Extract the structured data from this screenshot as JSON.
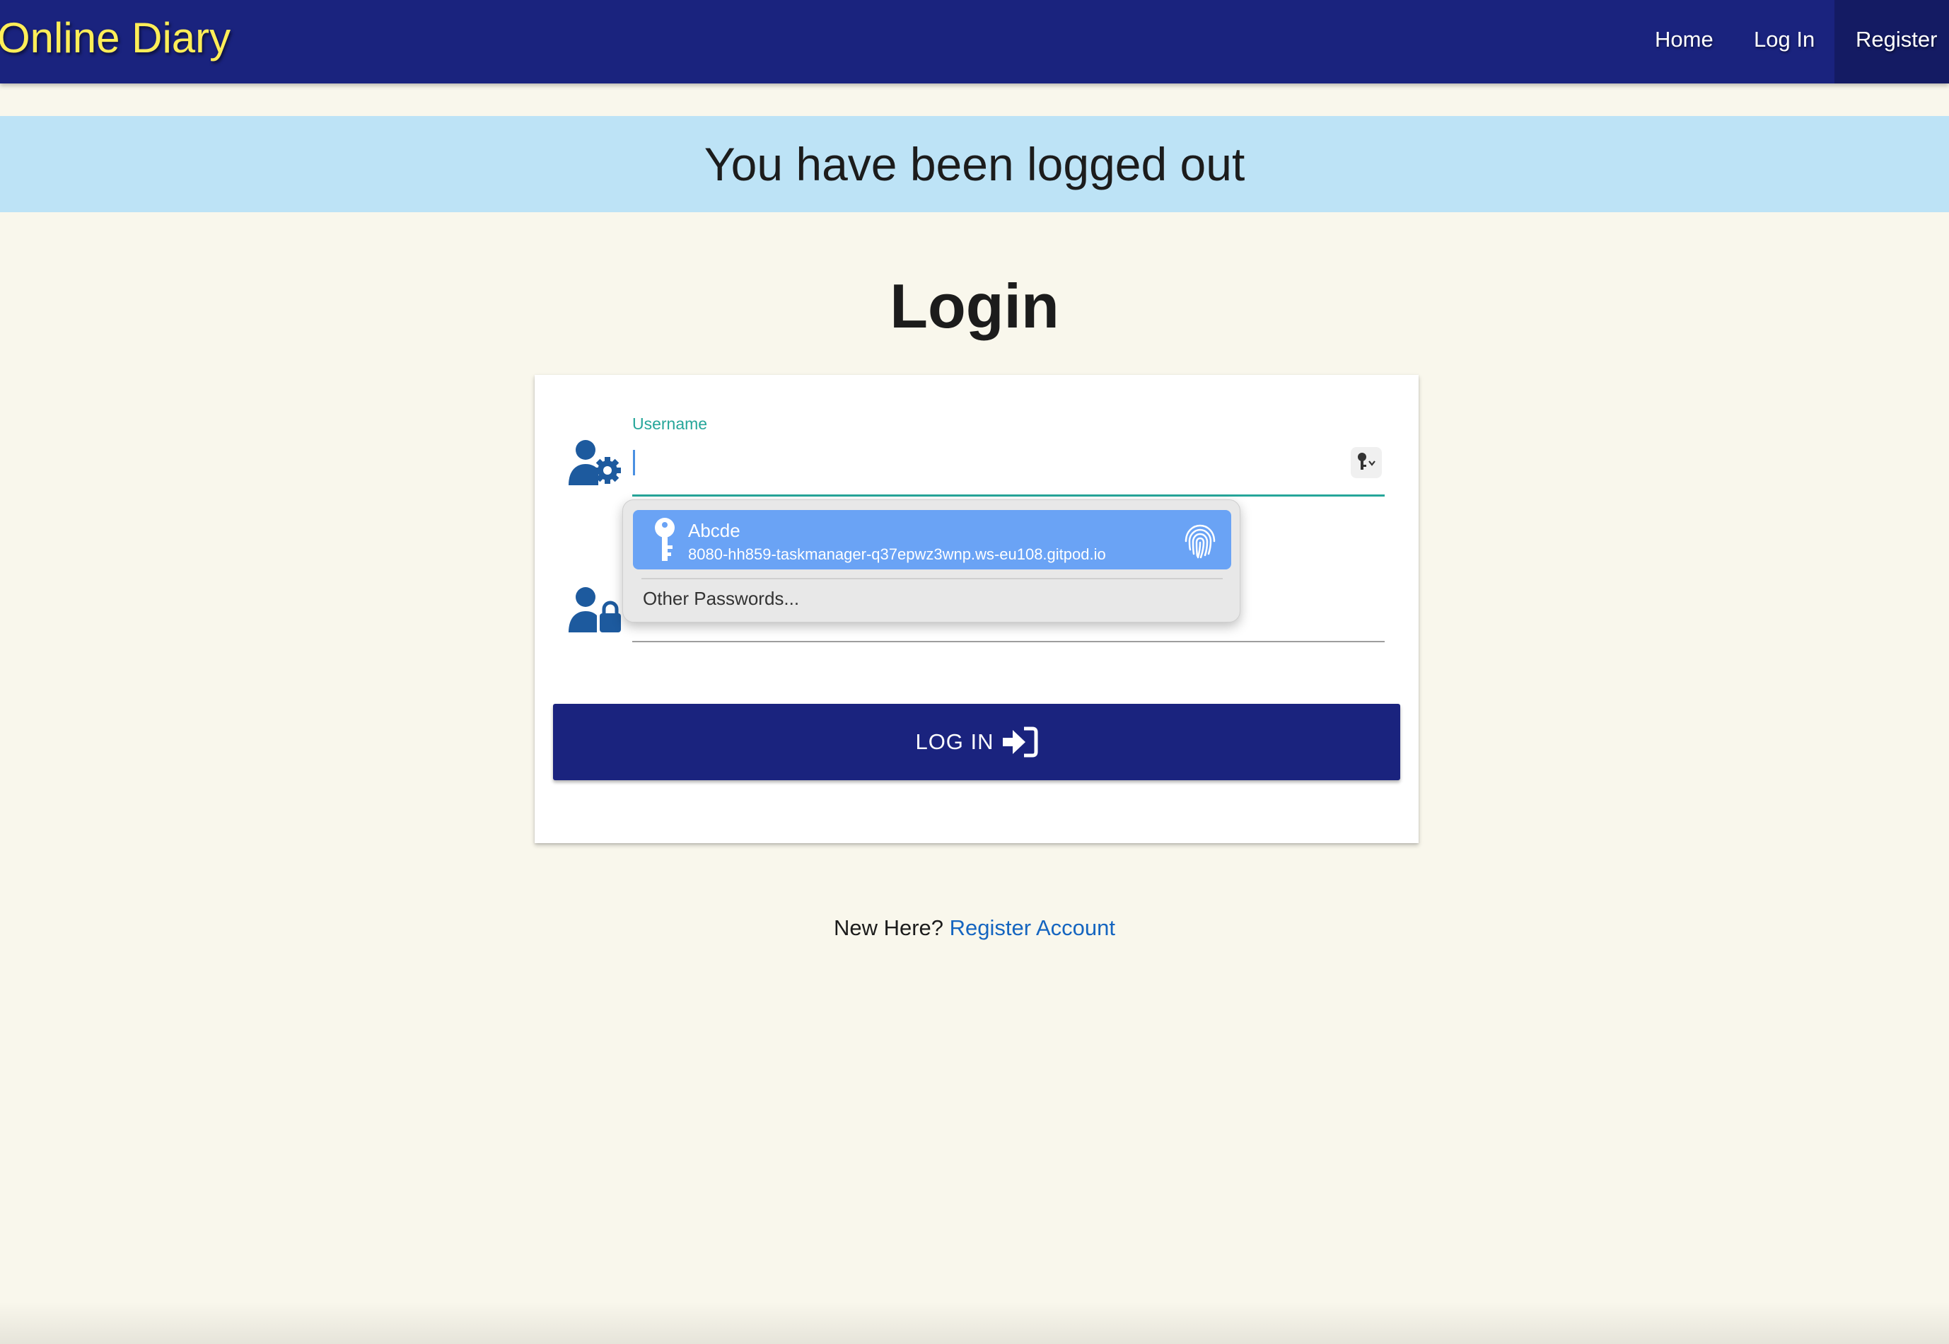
{
  "navbar": {
    "brand": "Online Diary",
    "links": [
      {
        "label": "Home"
      },
      {
        "label": "Log In"
      },
      {
        "label": "Register"
      }
    ],
    "color": "#1a237e",
    "brand_color": "#ffee58"
  },
  "flash": {
    "message": "You have been logged out",
    "color": "#bde3f6"
  },
  "page_title": "Login",
  "form": {
    "username_label": "Username",
    "username_value": "",
    "password_value": "",
    "username_icon": "user-gear-icon",
    "password_icon": "user-lock-icon",
    "submit_label": "LOG IN",
    "submit_icon": "sign-in-icon",
    "accent": "#26a69a"
  },
  "autofill": {
    "entry_name": "Abcde",
    "entry_site": "8080-hh859-taskmanager-q37epwz3wnp.ws-eu108.gitpod.io",
    "other_label": "Other Passwords...",
    "highlight": "#6aa3f5"
  },
  "footer": {
    "prompt": "New Here?",
    "link_label": "Register Account"
  }
}
